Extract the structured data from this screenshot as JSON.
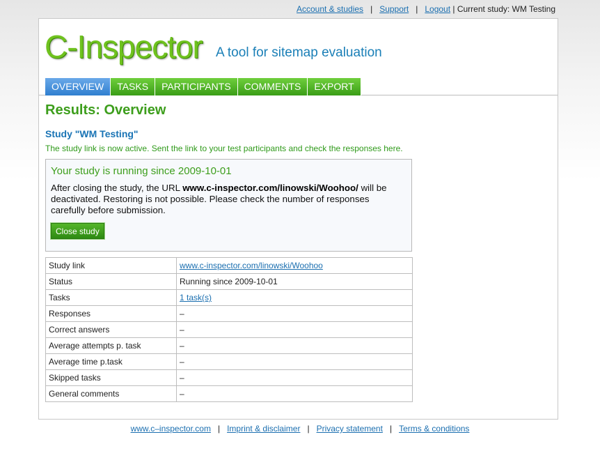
{
  "topnav": {
    "account": "Account & studies",
    "support": "Support",
    "logout": "Logout",
    "sep": "|",
    "current_study": "| Current study: WM Testing"
  },
  "header": {
    "logo": "C-Inspector",
    "tagline": "A tool for sitemap evaluation"
  },
  "tabs": [
    {
      "label": "OVERVIEW",
      "active": true
    },
    {
      "label": "TASKS",
      "active": false
    },
    {
      "label": "PARTICIPANTS",
      "active": false
    },
    {
      "label": "COMMENTS",
      "active": false
    },
    {
      "label": "EXPORT",
      "active": false
    }
  ],
  "main": {
    "title": "Results: Overview",
    "study_title": "Study \"WM Testing\"",
    "notice": "The study link is now active. Sent the link to your test participants and check the responses here."
  },
  "status_box": {
    "running": "Your study is running since 2009-10-01",
    "desc_before": "After closing the study, the URL ",
    "desc_url": "www.c-inspector.com/linowski/Woohoo/",
    "desc_after": " will be deactivated. Restoring is not possible. Please check the number of responses carefully before submission.",
    "close_button": "Close study"
  },
  "table": [
    {
      "label": "Study link",
      "value": "www.c-inspector.com/linowski/Woohoo",
      "link": true
    },
    {
      "label": "Status",
      "value": "Running since 2009-10-01",
      "link": false
    },
    {
      "label": "Tasks",
      "value": "1 task(s)",
      "link": true
    },
    {
      "label": "Responses",
      "value": "–",
      "link": false
    },
    {
      "label": "Correct answers",
      "value": "–",
      "link": false
    },
    {
      "label": "Average attempts p. task",
      "value": "–",
      "link": false
    },
    {
      "label": "Average time p.task",
      "value": "–",
      "link": false
    },
    {
      "label": "Skipped tasks",
      "value": "–",
      "link": false
    },
    {
      "label": "General comments",
      "value": "–",
      "link": false
    }
  ],
  "footer": {
    "site": "www.c–inspector.com",
    "imprint": "Imprint & disclaimer",
    "privacy": "Privacy statement",
    "terms": "Terms & conditions",
    "sep": "|"
  }
}
